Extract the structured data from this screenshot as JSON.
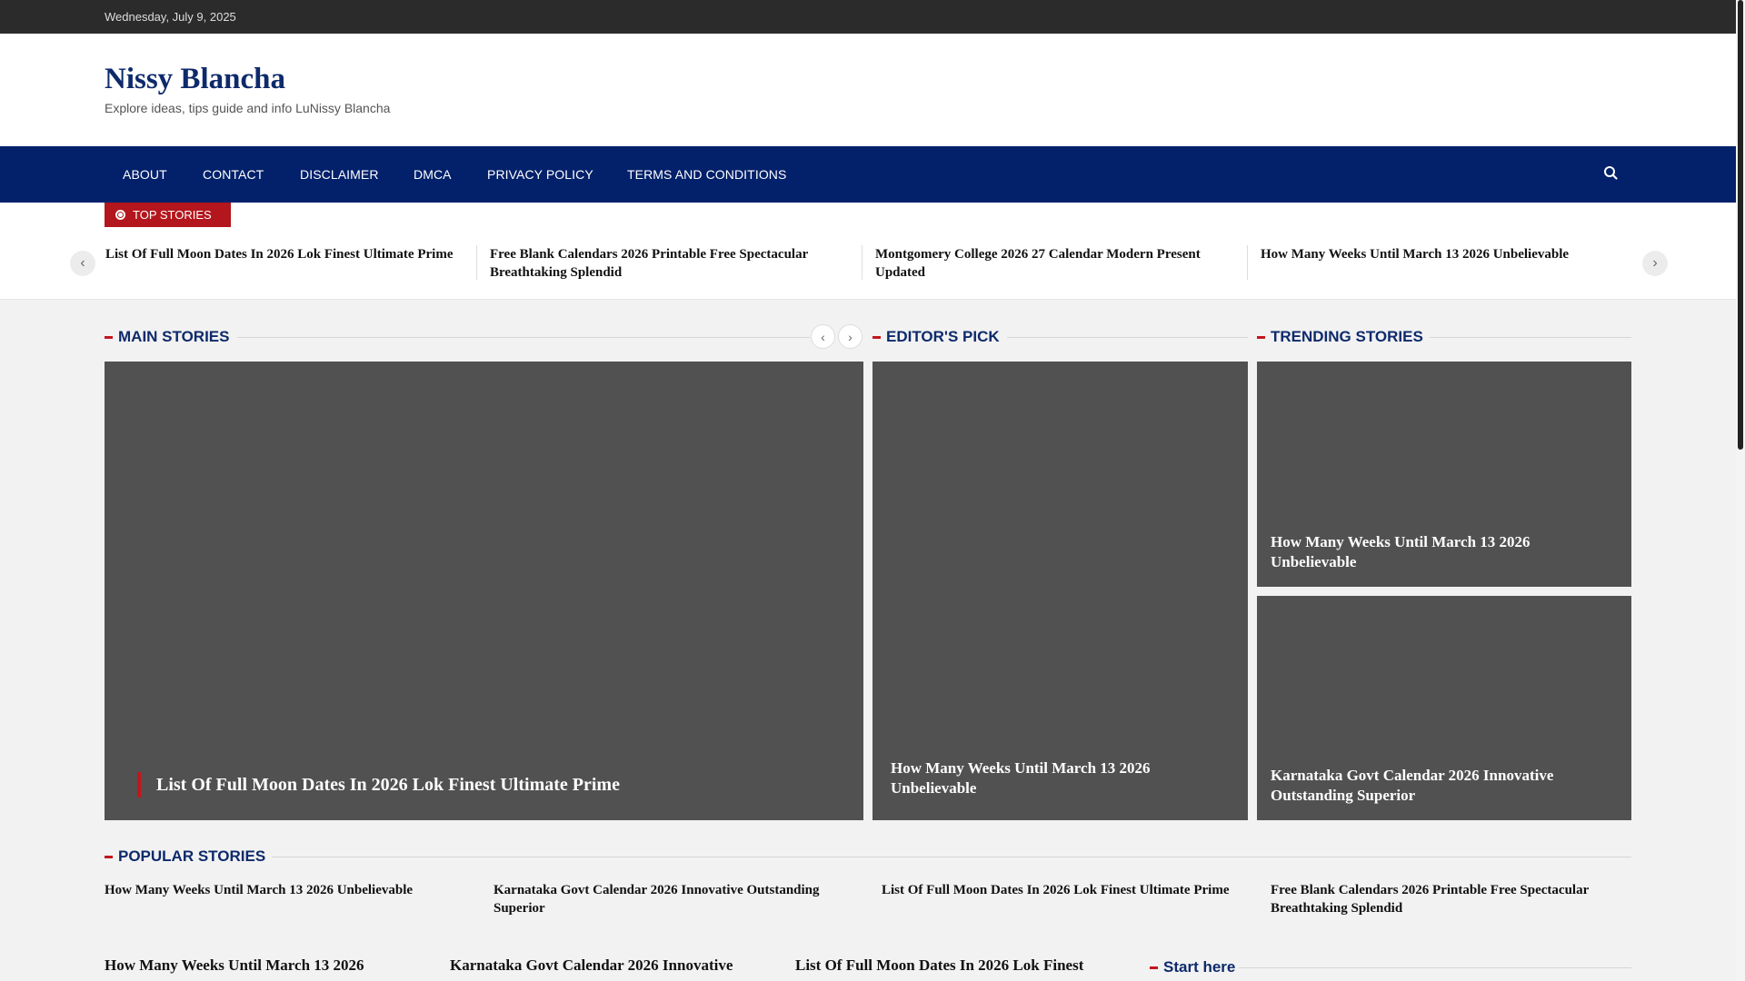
{
  "topbar": {
    "date": "Wednesday, July 9, 2025"
  },
  "header": {
    "title": "Nissy Blancha",
    "tagline": "Explore ideas, tips guide and info LuNissy Blancha"
  },
  "nav": {
    "items": [
      "ABOUT",
      "CONTACT",
      "DISCLAIMER",
      "DMCA",
      "PRIVACY POLICY",
      "TERMS AND CONDITIONS"
    ],
    "search_icon": "search-icon"
  },
  "top_stories": {
    "label": "TOP STORIES",
    "items": [
      "List Of Full Moon Dates In 2026 Lok Finest Ultimate Prime",
      "Free Blank Calendars 2026 Printable Free Spectacular Breathtaking Splendid",
      "Montgomery College 2026 27 Calendar Modern Present Updated",
      "How Many Weeks Until March 13 2026 Unbelievable"
    ]
  },
  "main_stories": {
    "label": "MAIN STORIES",
    "card_title": "List Of Full Moon Dates In 2026 Lok Finest Ultimate Prime"
  },
  "editors_pick": {
    "label": "EDITOR'S PICK",
    "card_title": "How Many Weeks Until March 13 2026 Unbelievable"
  },
  "trending": {
    "label": "TRENDING STORIES",
    "cards": [
      "How Many Weeks Until March 13 2026 Unbelievable",
      "Karnataka Govt Calendar 2026 Innovative Outstanding Superior"
    ]
  },
  "popular": {
    "label": "POPULAR STORIES",
    "items": [
      "How Many Weeks Until March 13 2026 Unbelievable",
      "Karnataka Govt Calendar 2026 Innovative Outstanding Superior",
      "List Of Full Moon Dates In 2026 Lok Finest Ultimate Prime",
      "Free Blank Calendars 2026 Printable Free Spectacular Breathtaking Splendid"
    ]
  },
  "bottom": {
    "items": [
      "How Many Weeks Until March 13 2026",
      "Karnataka Govt Calendar 2026 Innovative",
      "List Of Full Moon Dates In 2026 Lok Finest"
    ],
    "start_label": "Start here"
  },
  "colors": {
    "nav_bg": "#03216b",
    "accent_red": "#c4161c",
    "heading_blue": "#0e2a6b",
    "topbar_bg": "#2b2b2b",
    "card_bg": "#515151"
  }
}
